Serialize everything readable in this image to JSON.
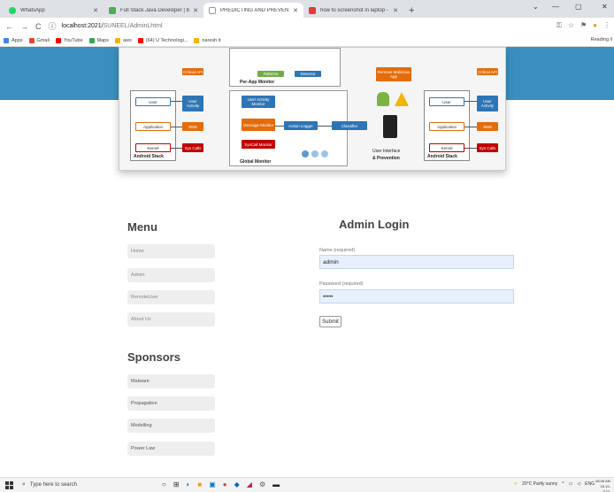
{
  "browser": {
    "tabs": [
      {
        "title": "WhatsApp",
        "color": "#25d366",
        "active": false
      },
      {
        "title": "Full Stack Java Developer | by Mr. Ch...",
        "color": "#4caf50",
        "active": false
      },
      {
        "title": "PREDICTING AND PREVENTION",
        "color": "#999999",
        "active": true
      },
      {
        "title": "how to screenshot in laptop - Yo...",
        "color": "#e53935",
        "active": false
      }
    ],
    "new_tab": "+",
    "address": {
      "scheme": "localhost:2021/",
      "path": "SUNEEL/AdminLhtml"
    },
    "bookmarks": [
      {
        "label": "Apps",
        "color": "#4285f4"
      },
      {
        "label": "Gmail",
        "color": "#ea4335"
      },
      {
        "label": "YouTube",
        "color": "#ff0000"
      },
      {
        "label": "Maps",
        "color": "#34a853"
      },
      {
        "label": "aws",
        "color": "#f4b400"
      },
      {
        "label": "(64) U Technologi...",
        "color": "#ff0000"
      },
      {
        "label": "naresh it",
        "color": "#f4b400"
      }
    ],
    "reading_list": "Reading li"
  },
  "diagram": {
    "per_app_monitor": "Per-App Monitor",
    "global_monitor": "Global Monitor",
    "android_stack_left": "Android Stack",
    "android_stack_right": "Android Stack",
    "user_interface": "User Interface",
    "prevention": "& Prevention",
    "blocks_left": [
      "User",
      "Application",
      "Kernel"
    ],
    "blocks_mid": [
      "User Activity",
      "SMS",
      "Sys Calls"
    ],
    "monitors": [
      "User Activity Monitor",
      "Message Monitor",
      "SysCall Monitor"
    ],
    "action_logger": "Action Logger",
    "classifier": "Classifier",
    "malware_app": "Remove Malicious App",
    "critical_api": "Critical API",
    "patterns": "Patterns",
    "detector": "Detector",
    "blocks_right": [
      "User",
      "Application",
      "Kernel"
    ],
    "blocks_right_mid": [
      "User Activity",
      "SMS",
      "Sys Calls"
    ]
  },
  "menu": {
    "title": "Menu",
    "items": [
      "Home",
      "Admin",
      "RemoteUser",
      "About Us"
    ]
  },
  "sponsors": {
    "title": "Sponsors",
    "items": [
      "Malware",
      "Propagation",
      "Modelling",
      "Power Law"
    ]
  },
  "login": {
    "title": "Admin Login",
    "name_label": "Name (required)",
    "name_value": "admin",
    "password_label": "Password (required)",
    "password_value": "•••••",
    "submit": "Submit"
  },
  "taskbar": {
    "search_placeholder": "Type here to search",
    "weather": "20°C Partly sunny",
    "lang": "ENG",
    "time": "08:06 AM",
    "date": "18-10-2021"
  }
}
